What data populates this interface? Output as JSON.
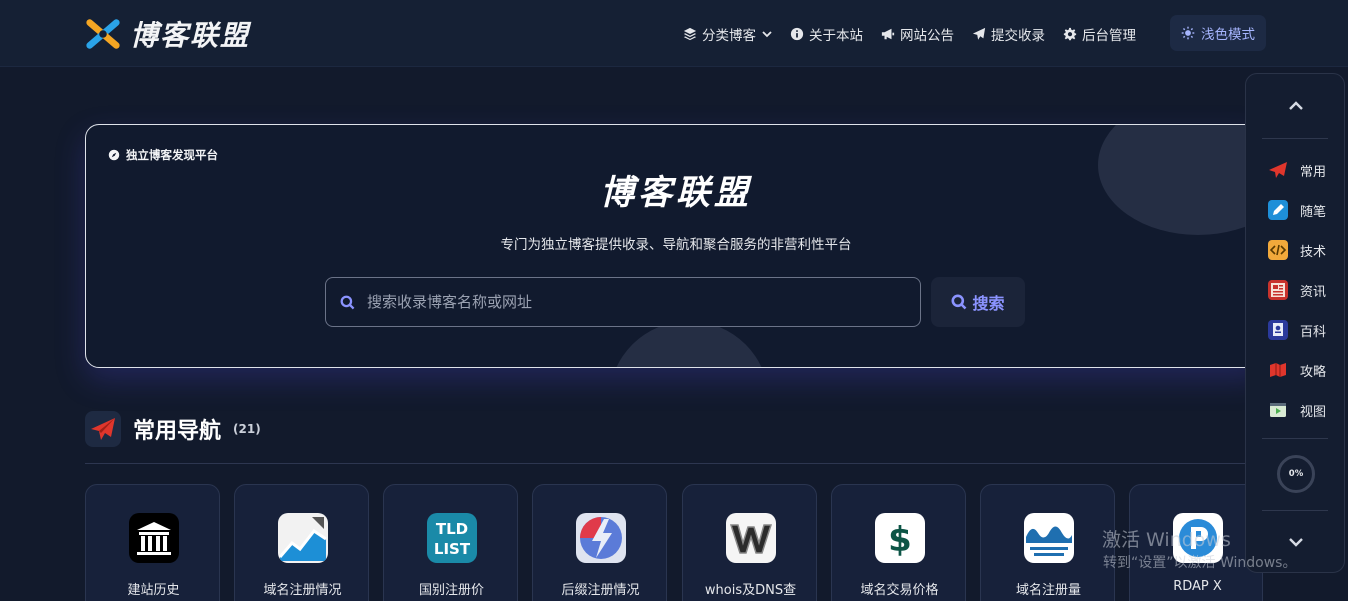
{
  "header": {
    "logo_text": "博客联盟",
    "logo_icon": "joomla-like-logo",
    "nav": [
      {
        "label": "分类博客",
        "icon": "layers-icon",
        "has_caret": true
      },
      {
        "label": "关于本站",
        "icon": "info-circle-icon"
      },
      {
        "label": "网站公告",
        "icon": "megaphone-icon"
      },
      {
        "label": "提交收录",
        "icon": "paper-plane-icon"
      },
      {
        "label": "后台管理",
        "icon": "gear-icon"
      }
    ],
    "mode_button": {
      "label": "浅色模式",
      "icon": "sun-icon"
    }
  },
  "hero": {
    "badge": "独立博客发现平台",
    "title": "博客联盟",
    "subtitle": "专门为独立博客提供收录、导航和聚合服务的非营利性平台",
    "search_placeholder": "搜索收录博客名称或网址",
    "search_button": "搜索"
  },
  "section": {
    "title": "常用导航",
    "count": "(21)",
    "icon": "paper-plane-icon"
  },
  "cards": [
    {
      "label": "建站历史",
      "icon": "museum-icon"
    },
    {
      "label": "域名注册情况",
      "icon": "chart-icon"
    },
    {
      "label": "国别注册价",
      "icon": "tld-list-icon"
    },
    {
      "label": "后缀注册情况",
      "icon": "flash-icon"
    },
    {
      "label": "whois及DNS查",
      "icon": "w-icon"
    },
    {
      "label": "域名交易价格",
      "icon": "dollar-icon"
    },
    {
      "label": "域名注册量",
      "icon": "wave-icon"
    },
    {
      "label": "RDAP X",
      "icon": "rdap-icon"
    }
  ],
  "side_panel": {
    "items": [
      {
        "label": "常用",
        "icon": "paper-plane-icon"
      },
      {
        "label": "随笔",
        "icon": "pen-icon"
      },
      {
        "label": "技术",
        "icon": "code-icon"
      },
      {
        "label": "资讯",
        "icon": "newspaper-icon"
      },
      {
        "label": "百科",
        "icon": "book-icon"
      },
      {
        "label": "攻略",
        "icon": "map-icon"
      },
      {
        "label": "视图",
        "icon": "video-icon"
      }
    ],
    "progress": "0%"
  },
  "watermark": {
    "line1": "激活 Windows",
    "line2": "转到“设置”以激活 Windows。"
  }
}
